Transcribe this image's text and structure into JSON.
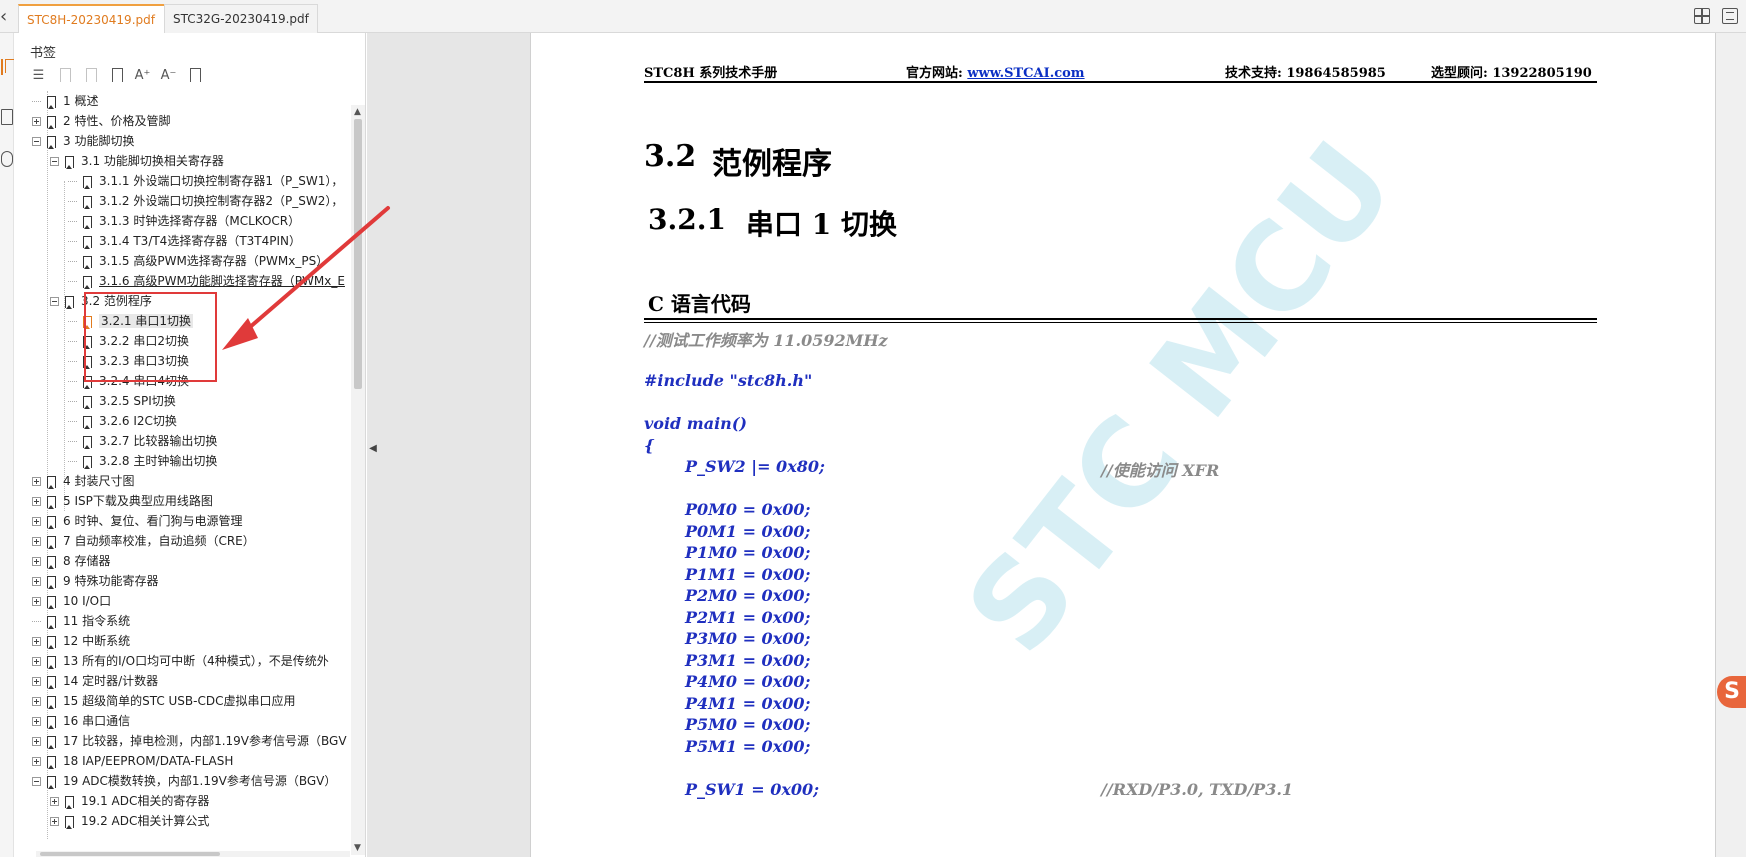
{
  "tabs": [
    {
      "label": "STC8H-20230419.pdf",
      "active": true
    },
    {
      "label": "STC32G-20230419.pdf",
      "active": false
    }
  ],
  "tab_close_glyph": "×",
  "panel": {
    "title": "书签",
    "toolbar_icons": [
      "list-icon",
      "delete-bookmark-icon",
      "add-bookmark-icon",
      "new-bookmark-icon",
      "increase-font-icon",
      "decrease-font-icon",
      "find-bookmark-icon"
    ],
    "toolbar_glyphs": {
      "increase": "A⁺",
      "decrease": "A⁻"
    }
  },
  "bookmarks": [
    {
      "label": "1 概述",
      "level": 0,
      "expander": "none"
    },
    {
      "label": "2 特性、价格及管脚",
      "level": 0,
      "expander": "plus"
    },
    {
      "label": "3 功能脚切换",
      "level": 0,
      "expander": "minus"
    },
    {
      "label": "3.1 功能脚切换相关寄存器",
      "level": 1,
      "expander": "minus"
    },
    {
      "label": "3.1.1 外设端口切换控制寄存器1（P_SW1），",
      "level": 2,
      "expander": "none"
    },
    {
      "label": "3.1.2 外设端口切换控制寄存器2（P_SW2），",
      "level": 2,
      "expander": "none"
    },
    {
      "label": "3.1.3 时钟选择寄存器（MCLKOCR）",
      "level": 2,
      "expander": "none"
    },
    {
      "label": "3.1.4 T3/T4选择寄存器（T3T4PIN）",
      "level": 2,
      "expander": "none"
    },
    {
      "label": "3.1.5 高级PWM选择寄存器（PWMx_PS）",
      "level": 2,
      "expander": "none"
    },
    {
      "label": "3.1.6 高级PWM功能脚选择寄存器（PWMx_E",
      "level": 2,
      "expander": "none",
      "underline": true
    },
    {
      "label": "3.2 范例程序",
      "level": 1,
      "expander": "minus"
    },
    {
      "label": "3.2.1 串口1切换",
      "level": 2,
      "expander": "none",
      "selected": true
    },
    {
      "label": "3.2.2 串口2切换",
      "level": 2,
      "expander": "none"
    },
    {
      "label": "3.2.3 串口3切换",
      "level": 2,
      "expander": "none"
    },
    {
      "label": "3.2.4 串口4切换",
      "level": 2,
      "expander": "none"
    },
    {
      "label": "3.2.5 SPI切换",
      "level": 2,
      "expander": "none"
    },
    {
      "label": "3.2.6 I2C切换",
      "level": 2,
      "expander": "none"
    },
    {
      "label": "3.2.7 比较器输出切换",
      "level": 2,
      "expander": "none"
    },
    {
      "label": "3.2.8 主时钟输出切换",
      "level": 2,
      "expander": "none"
    },
    {
      "label": "4 封装尺寸图",
      "level": 0,
      "expander": "plus"
    },
    {
      "label": "5 ISP下载及典型应用线路图",
      "level": 0,
      "expander": "plus"
    },
    {
      "label": "6 时钟、复位、看门狗与电源管理",
      "level": 0,
      "expander": "plus"
    },
    {
      "label": "7 自动频率校准，自动追频（CRE）",
      "level": 0,
      "expander": "plus"
    },
    {
      "label": "8 存储器",
      "level": 0,
      "expander": "plus"
    },
    {
      "label": "9 特殊功能寄存器",
      "level": 0,
      "expander": "plus"
    },
    {
      "label": "10 I/O口",
      "level": 0,
      "expander": "plus"
    },
    {
      "label": "11 指令系统",
      "level": 0,
      "expander": "none"
    },
    {
      "label": "12 中断系统",
      "level": 0,
      "expander": "plus"
    },
    {
      "label": "13 所有的I/O口均可中断（4种模式），不是传统外",
      "level": 0,
      "expander": "plus"
    },
    {
      "label": "14 定时器/计数器",
      "level": 0,
      "expander": "plus"
    },
    {
      "label": "15 超级简单的STC USB-CDC虚拟串口应用",
      "level": 0,
      "expander": "plus"
    },
    {
      "label": "16 串口通信",
      "level": 0,
      "expander": "plus"
    },
    {
      "label": "17 比较器，掉电检测，内部1.19V参考信号源（BGV",
      "level": 0,
      "expander": "plus"
    },
    {
      "label": "18 IAP/EEPROM/DATA-FLASH",
      "level": 0,
      "expander": "plus"
    },
    {
      "label": "19 ADC模数转换，内部1.19V参考信号源（BGV）",
      "level": 0,
      "expander": "minus"
    },
    {
      "label": "19.1 ADC相关的寄存器",
      "level": 1,
      "expander": "plus"
    },
    {
      "label": "19.2 ADC相关计算公式",
      "level": 1,
      "expander": "plus"
    }
  ],
  "document": {
    "header": {
      "manual": "STC8H 系列技术手册",
      "site_label": "官方网站: ",
      "site_link": "www.STCAI.com",
      "support": "技术支持: 19864585985",
      "advisor": "选型顾问: 13922805190"
    },
    "section_number": "3.2",
    "section_title": "范例程序",
    "subsection_number": "3.2.1",
    "subsection_title": "串口 1 切换",
    "code_heading": "C 语言代码",
    "code_lines": [
      {
        "text": "//测试工作频率为 11.0592MHz",
        "kind": "comment",
        "indent": 0
      },
      {
        "text": "#include \"stc8h.h\"",
        "kind": "code",
        "indent": 0
      },
      {
        "text": "void main()",
        "kind": "code",
        "indent": 0
      },
      {
        "text": "{",
        "kind": "code",
        "indent": 0
      },
      {
        "text": "P_SW2 |= 0x80;",
        "kind": "code",
        "indent": 1,
        "comment": "//使能访问 XFR"
      },
      {
        "text": "P0M0 = 0x00;",
        "kind": "code",
        "indent": 1
      },
      {
        "text": "P0M1 = 0x00;",
        "kind": "code",
        "indent": 1
      },
      {
        "text": "P1M0 = 0x00;",
        "kind": "code",
        "indent": 1
      },
      {
        "text": "P1M1 = 0x00;",
        "kind": "code",
        "indent": 1
      },
      {
        "text": "P2M0 = 0x00;",
        "kind": "code",
        "indent": 1
      },
      {
        "text": "P2M1 = 0x00;",
        "kind": "code",
        "indent": 1
      },
      {
        "text": "P3M0 = 0x00;",
        "kind": "code",
        "indent": 1
      },
      {
        "text": "P3M1 = 0x00;",
        "kind": "code",
        "indent": 1
      },
      {
        "text": "P4M0 = 0x00;",
        "kind": "code",
        "indent": 1
      },
      {
        "text": "P4M1 = 0x00;",
        "kind": "code",
        "indent": 1
      },
      {
        "text": "P5M0 = 0x00;",
        "kind": "code",
        "indent": 1
      },
      {
        "text": "P5M1 = 0x00;",
        "kind": "code",
        "indent": 1
      },
      {
        "text": "P_SW1 = 0x00;",
        "kind": "code",
        "indent": 1,
        "comment": "//RXD/P3.0, TXD/P3.1"
      }
    ],
    "watermark": "STC MCU"
  },
  "colors": {
    "accent": "#e07b1f",
    "annotation": "#e03a3a",
    "code": "#1f2fbf",
    "comment": "#8a8a8a",
    "link": "#0b2fc4"
  },
  "side_logo": "S"
}
